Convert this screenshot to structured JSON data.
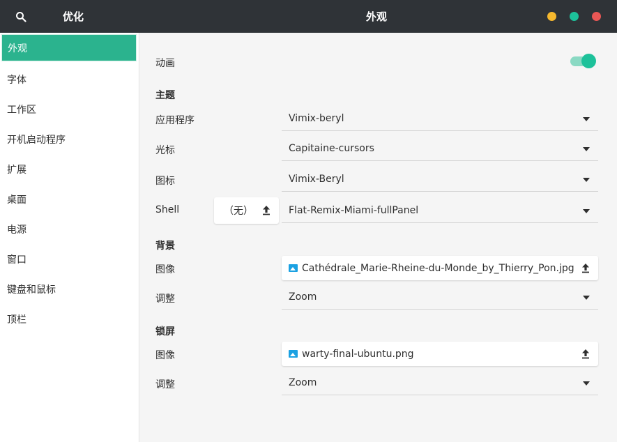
{
  "header": {
    "app_title": "优化",
    "page_title": "外观",
    "search_icon": "search-icon",
    "window_buttons": {
      "minimize_color": "#f5b82e",
      "maximize_color": "#1dc19a",
      "close_color": "#e95755"
    }
  },
  "sidebar": {
    "items": [
      {
        "label": "外观",
        "active": true
      },
      {
        "label": "字体"
      },
      {
        "label": "工作区"
      },
      {
        "label": "开机启动程序"
      },
      {
        "label": "扩展"
      },
      {
        "label": "桌面"
      },
      {
        "label": "电源"
      },
      {
        "label": "窗口"
      },
      {
        "label": "键盘和鼠标"
      },
      {
        "label": "顶栏"
      }
    ]
  },
  "main": {
    "animation": {
      "label": "动画",
      "enabled": true
    },
    "themes": {
      "title": "主题",
      "applications": {
        "label": "应用程序",
        "value": "Vimix-beryl"
      },
      "cursor": {
        "label": "光标",
        "value": "Capitaine-cursors"
      },
      "icons": {
        "label": "图标",
        "value": "Vimix-Beryl"
      },
      "shell": {
        "label": "Shell",
        "none_button": "（无）",
        "value": "Flat-Remix-Miami-fullPanel"
      }
    },
    "background": {
      "title": "背景",
      "image": {
        "label": "图像",
        "value": "Cathédrale_Marie-Rheine-du-Monde_by_Thierry_Pon.jpg"
      },
      "adjustment": {
        "label": "调整",
        "value": "Zoom"
      }
    },
    "lock_screen": {
      "title": "锁屏",
      "image": {
        "label": "图像",
        "value": "warty-final-ubuntu.png"
      },
      "adjustment": {
        "label": "调整",
        "value": "Zoom"
      }
    }
  },
  "colors": {
    "accent": "#2bb38e",
    "header_bg": "#2f3337",
    "panel_bg": "#f5f5f5"
  }
}
